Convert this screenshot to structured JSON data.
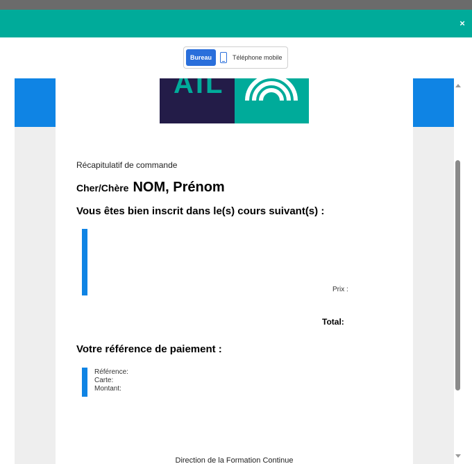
{
  "header": {
    "close_label": "×"
  },
  "device_toggle": {
    "active_label": "Bureau",
    "mobile_label": "Téléphone mobile"
  },
  "logo": {
    "text": "AIL"
  },
  "email": {
    "recap_title": "Récapitulatif de commande",
    "greeting_prefix": "Cher/Chère",
    "greeting_name": "NOM, Prénom",
    "courses_heading": "Vous êtes bien inscrit dans le(s) cours suivant(s) :",
    "price_label": "Prix :",
    "total_label": "Total:",
    "payment_heading": "Votre référence de paiement :",
    "reference_label": "Référence:",
    "card_label": "Carte:",
    "amount_label": "Montant:",
    "footer_text": "Direction de la Formation Continue"
  },
  "colors": {
    "teal": "#00ab9a",
    "blue": "#0f84e4",
    "navy": "#231c48",
    "toggle_active": "#2a6fdb"
  }
}
